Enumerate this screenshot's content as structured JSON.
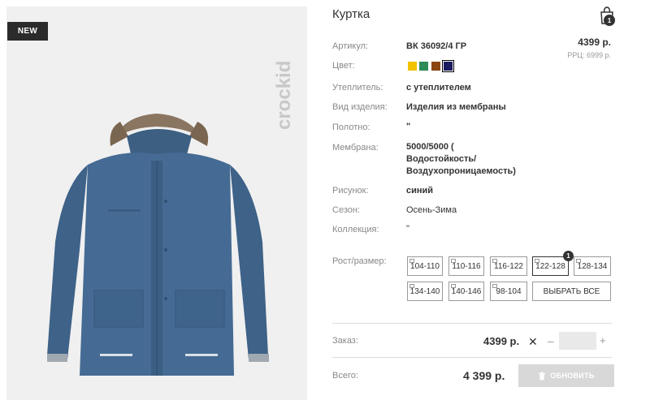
{
  "badge": "NEW",
  "brand": "crockid",
  "title": "Куртка",
  "cart": {
    "count": "1"
  },
  "price": "4399 р.",
  "price_rrc": "РРЦ: 6999 р.",
  "colors": [
    {
      "hex": "#f2c200",
      "selected": false
    },
    {
      "hex": "#2e8b57",
      "selected": false
    },
    {
      "hex": "#8b4513",
      "selected": false
    },
    {
      "hex": "#1a1a5e",
      "selected": true
    }
  ],
  "specs": {
    "article": {
      "label": "Артикул:",
      "value": "ВК 36092/4 ГР"
    },
    "color": {
      "label": "Цвет:"
    },
    "insulation": {
      "label": "Утеплитель:",
      "value": "с утеплителем"
    },
    "type": {
      "label": "Вид изделия:",
      "value": "Изделия из мембраны"
    },
    "fabric": {
      "label": "Полотно:",
      "value": "\""
    },
    "membrane": {
      "label": "Мембрана:",
      "line1": "5000/5000 (",
      "line2": "Водостойкость/",
      "line3": "Воздухопроницаемость)"
    },
    "pattern": {
      "label": "Рисунок:",
      "value": "синий"
    },
    "season": {
      "label": "Сезон:",
      "value": "Осень-Зима"
    },
    "collection": {
      "label": "Коллекция:",
      "value": "\""
    }
  },
  "sizes": {
    "label": "Рост/размер:",
    "options": [
      "104-110",
      "110-116",
      "116-122",
      "122-128",
      "128-134",
      "134-140",
      "140-146",
      "98-104"
    ],
    "selected": "122-128",
    "selected_count": "1",
    "select_all": "ВЫБРАТЬ ВСЕ"
  },
  "order": {
    "label": "Заказ:",
    "price": "4399 р.",
    "remove": "✕",
    "minus": "–",
    "plus": "+",
    "quantity": ""
  },
  "total": {
    "label": "Всего:",
    "value": "4 399 р.",
    "button": "ОБНОВИТЬ"
  }
}
